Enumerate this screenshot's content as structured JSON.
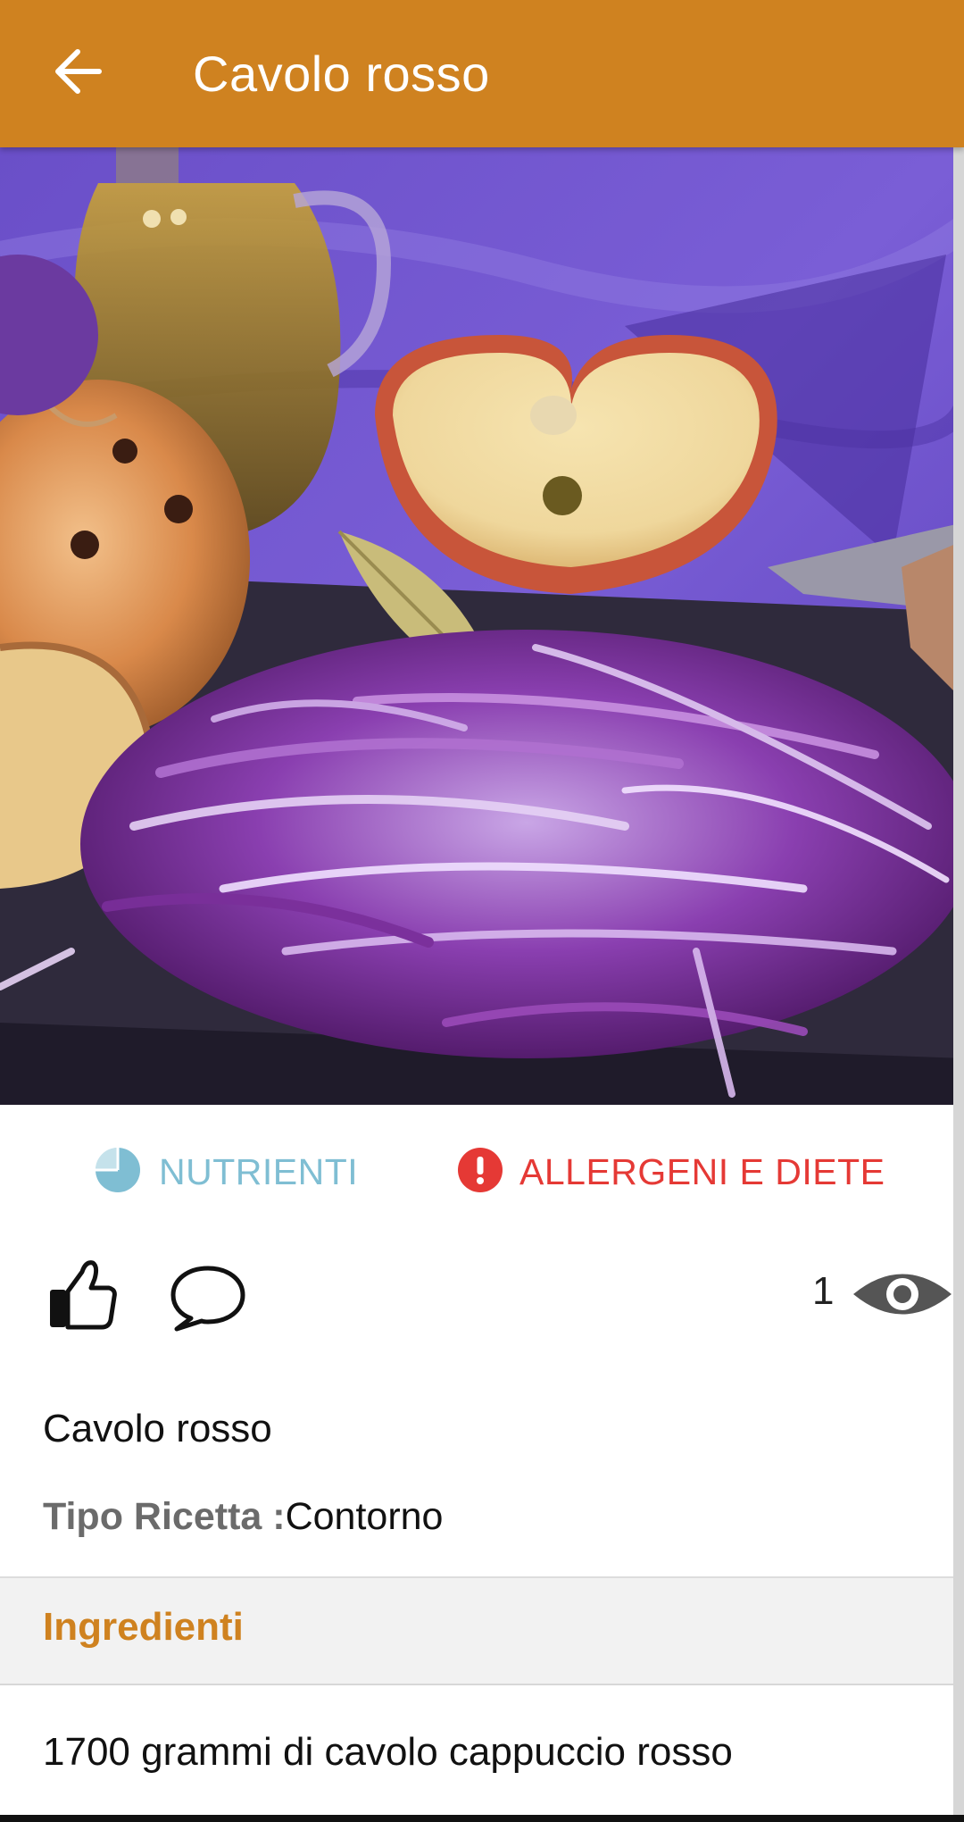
{
  "app_bar": {
    "title": "Cavolo rosso",
    "background": "#cf8220",
    "back_icon": "arrow-left-icon"
  },
  "hero_image": {
    "subject": "red cabbage salad"
  },
  "tabs": {
    "nutrienti": {
      "label": "NUTRIENTI",
      "icon": "pie-chart-icon",
      "color": "#7fbed3"
    },
    "allergeni": {
      "label": "ALLERGENI E DIETE",
      "icon": "alert-icon",
      "color": "#e53935"
    }
  },
  "actions": {
    "like_icon": "thumbs-up-icon",
    "comment_icon": "comment-icon",
    "views_count": "1",
    "views_icon": "eye-icon"
  },
  "recipe": {
    "name": "Cavolo rosso",
    "type_label": "Tipo Ricetta :",
    "type_value": "Contorno"
  },
  "ingredients": {
    "title": "Ingredienti",
    "items": [
      "1700 grammi di cavolo cappuccio rosso"
    ]
  }
}
